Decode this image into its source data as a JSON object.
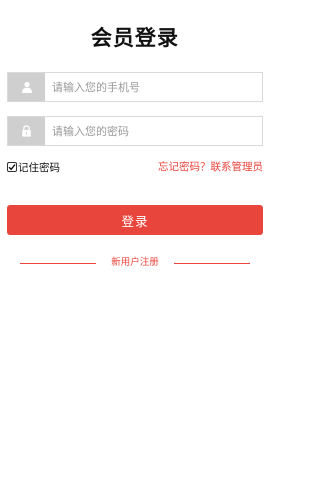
{
  "title": "会员登录",
  "phone_field": {
    "placeholder": "请输入您的手机号",
    "value": "",
    "icon": "user-icon"
  },
  "password_field": {
    "placeholder": "请输入您的密码",
    "value": "",
    "icon": "lock-icon"
  },
  "remember": {
    "label": "记住密码",
    "checked": true
  },
  "forgot_link": "忘记密码？联系管理员",
  "login_button": "登录",
  "register_link": "新用户注册",
  "colors": {
    "accent": "#e8453c",
    "icon_box": "#cfcfcf",
    "border": "#d9d9d9"
  }
}
